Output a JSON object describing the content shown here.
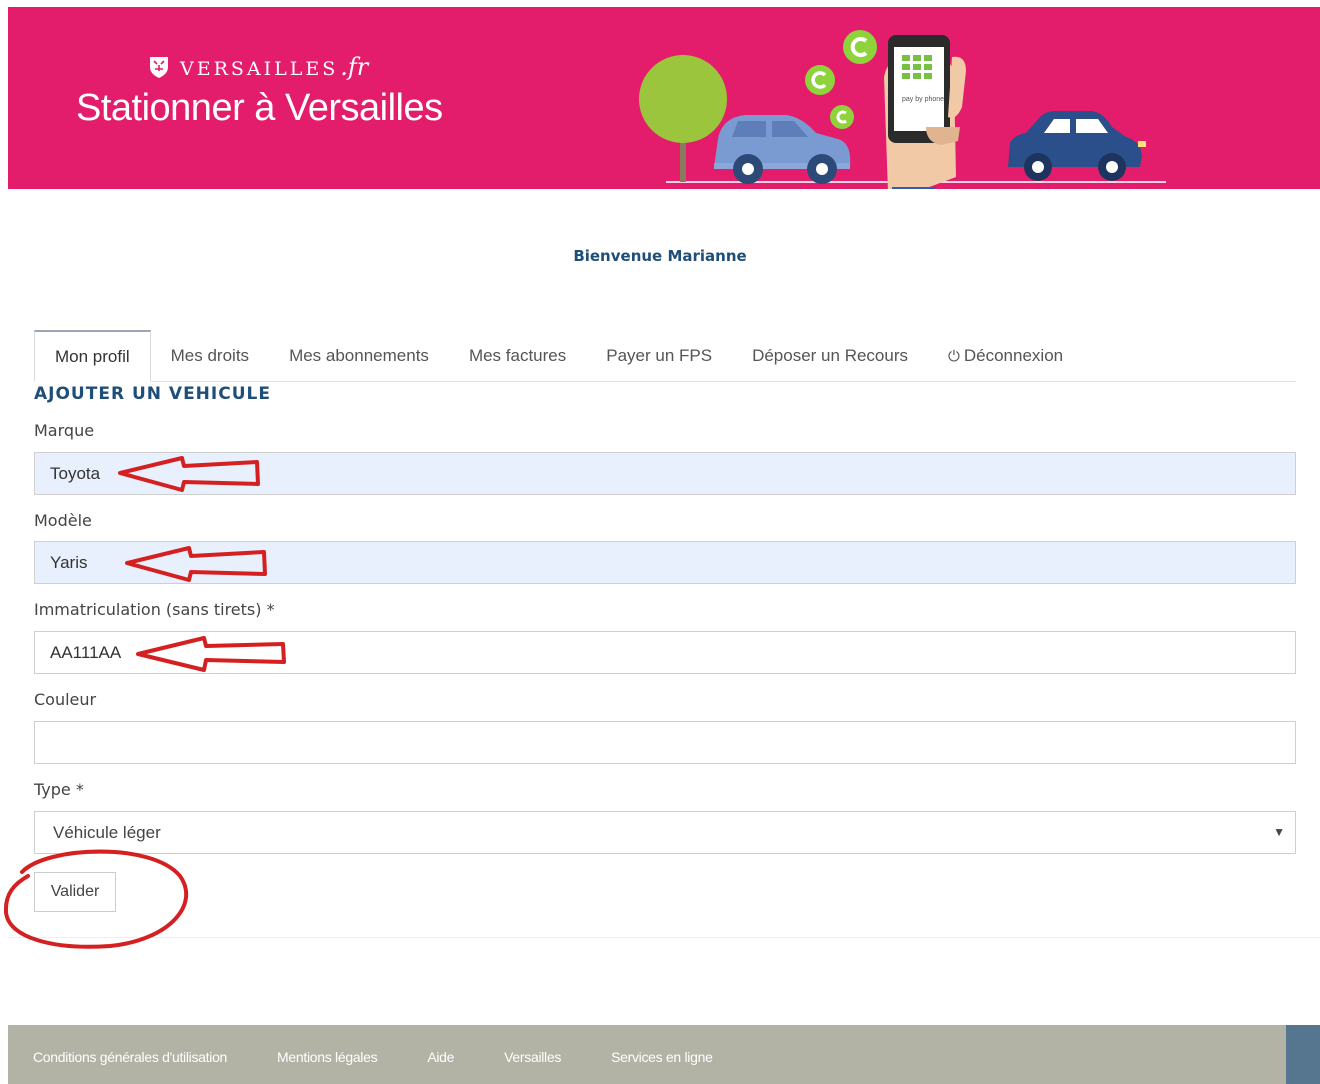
{
  "header": {
    "brand_name": "VERSAILLES",
    "brand_suffix": ".fr",
    "site_title": "Stationner à Versailles",
    "illustration_text": "pay by phone",
    "banner_color": "#e31d6b",
    "icons": [
      "crest-icon",
      "tree-icon",
      "car-icon",
      "phone-icon",
      "coin-icon"
    ]
  },
  "welcome": "Bienvenue Marianne",
  "tabs": [
    {
      "label": "Mon profil",
      "active": true
    },
    {
      "label": "Mes droits"
    },
    {
      "label": "Mes abonnements"
    },
    {
      "label": "Mes factures"
    },
    {
      "label": "Payer un FPS"
    },
    {
      "label": "Déposer un Recours"
    },
    {
      "label": "Déconnexion",
      "icon": "power-icon"
    }
  ],
  "form": {
    "title": "AJOUTER UN VEHICULE",
    "marque_label": "Marque",
    "marque_value": "Toyota",
    "modele_label": "Modèle",
    "modele_value": "Yaris",
    "immat_label": "Immatriculation (sans tirets) *",
    "immat_value": "AA111AA",
    "couleur_label": "Couleur",
    "couleur_value": "",
    "type_label": "Type *",
    "type_value": "Véhicule léger",
    "submit_label": "Valider"
  },
  "footer": {
    "links": [
      "Conditions générales d'utilisation",
      "Mentions légales",
      "Aide",
      "Versailles",
      "Services en ligne"
    ],
    "bg_color": "#b2b2a5",
    "accent_color": "#56758f"
  },
  "annotation_color": "#d42020"
}
